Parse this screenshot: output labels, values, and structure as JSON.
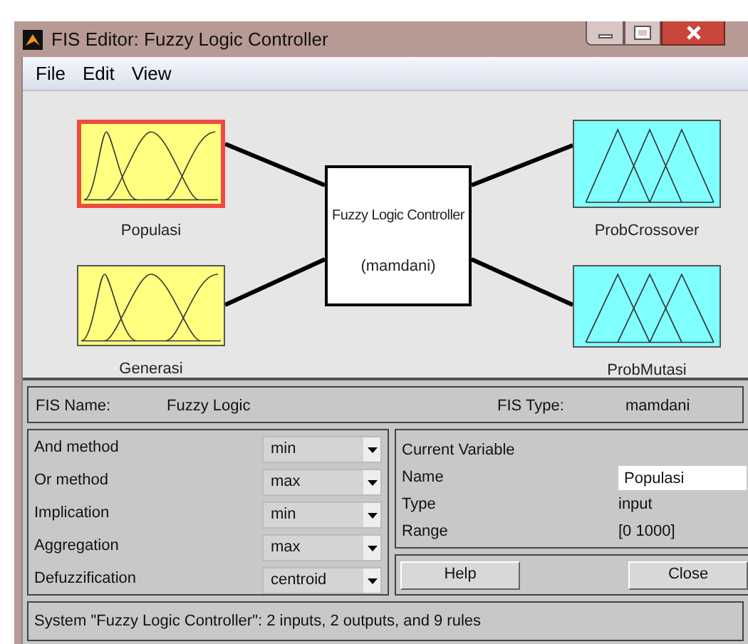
{
  "window": {
    "title": "FIS Editor: Fuzzy Logic Controller"
  },
  "menu": [
    "File",
    "Edit",
    "View"
  ],
  "diagram": {
    "inputs": [
      {
        "label": "Populasi",
        "kind": "gauss",
        "selected": true
      },
      {
        "label": "Generasi",
        "kind": "gauss",
        "selected": false
      }
    ],
    "system": {
      "name": "Fuzzy Logic Controller",
      "type": "(mamdani)"
    },
    "outputs": [
      {
        "label": "ProbCrossover",
        "kind": "trimf",
        "selected": false
      },
      {
        "label": "ProbMutasi",
        "kind": "trimf",
        "selected": false
      }
    ]
  },
  "fis_name": {
    "label": "FIS Name:",
    "value": "Fuzzy Logic"
  },
  "fis_type": {
    "label": "FIS Type:",
    "value": "mamdani"
  },
  "methods": [
    {
      "label": "And method",
      "value": "min"
    },
    {
      "label": "Or method",
      "value": "max"
    },
    {
      "label": "Implication",
      "value": "min"
    },
    {
      "label": "Aggregation",
      "value": "max"
    },
    {
      "label": "Defuzzification",
      "value": "centroid"
    }
  ],
  "current_variable": {
    "title": "Current Variable",
    "name_label": "Name",
    "name_value": "Populasi",
    "type_label": "Type",
    "type_value": "input",
    "range_label": "Range",
    "range_value": "[0 1000]"
  },
  "buttons": [
    "Help",
    "Close"
  ],
  "status_bar": "System \"Fuzzy Logic Controller\": 2 inputs, 2 outputs, and 9 rules"
}
